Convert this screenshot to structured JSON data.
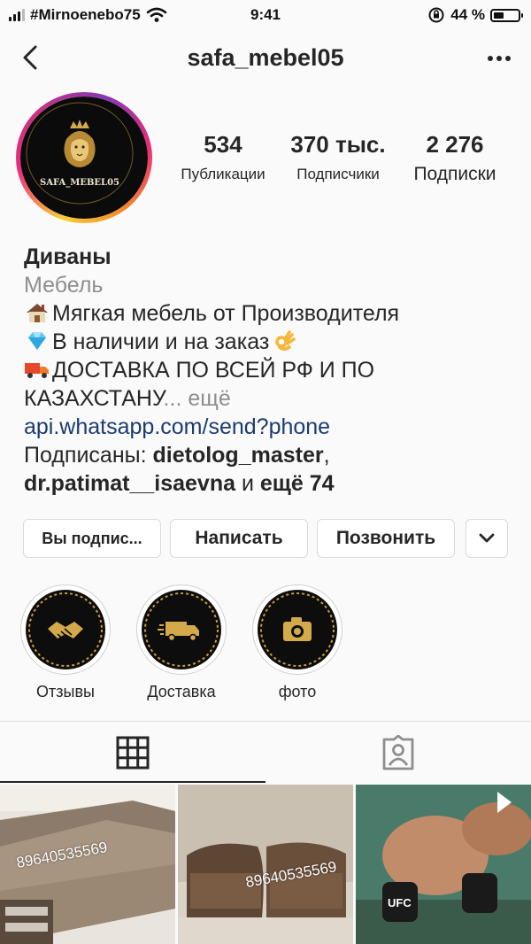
{
  "status_bar": {
    "carrier": "#Mirnoenebo75",
    "time": "9:41",
    "battery": "44 %",
    "battery_level": 0.44
  },
  "header": {
    "username": "safa_mebel05"
  },
  "profile": {
    "avatar_text": "SAFA_MEBEL05",
    "stats": [
      {
        "value": "534",
        "label": "Публикации"
      },
      {
        "value": "370 тыс.",
        "label": "Подписчики"
      },
      {
        "value": "2 276",
        "label": "Подписки"
      }
    ]
  },
  "bio": {
    "name": "Диваны",
    "category": "Мебель",
    "line1": "Мягкая мебель от Производителя",
    "line2": "В наличии и на заказ",
    "line3": "ДОСТАВКА ПО ВСЕЙ РФ И ПО",
    "line4": "КАЗАХСТАНУ",
    "ellipsis": "...",
    "more": "ещё",
    "link": "api.whatsapp.com/send?phone",
    "followed_prefix": "Подписаны:",
    "followed_user1": "dietolog_master",
    "comma": ",",
    "followed_user2": "dr.patimat__isaevna",
    "followed_and": "и",
    "followed_more": "ещё 74"
  },
  "buttons": {
    "following": "Вы подпис...",
    "message": "Написать",
    "call": "Позвонить"
  },
  "highlights": [
    {
      "label": "Отзывы",
      "icon": "handshake-icon"
    },
    {
      "label": "Доставка",
      "icon": "truck-icon"
    },
    {
      "label": "фото",
      "icon": "camera-icon"
    }
  ],
  "posts": [
    {
      "phone": "89640535569"
    },
    {
      "phone": "89640535569"
    },
    {
      "type": "video",
      "icon": "play-icon",
      "text": "UFC"
    }
  ],
  "colors": {
    "link": "#1a3b73",
    "muted": "#8e8e8e",
    "gold": "#d4a94a"
  }
}
